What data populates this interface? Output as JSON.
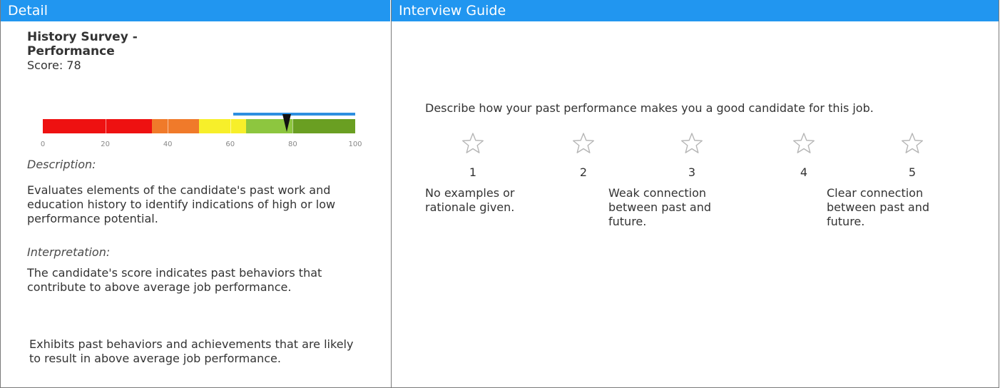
{
  "detail": {
    "header": "Detail",
    "title": "History Survey - Performance",
    "score_text": "Score: 78",
    "gauge": {
      "score": 78,
      "range": [
        0,
        100
      ],
      "above_average_band": [
        60,
        100
      ],
      "segments": [
        {
          "from": 0,
          "to": 35,
          "color": "#ee1111"
        },
        {
          "from": 35,
          "to": 50,
          "color": "#f07a2a"
        },
        {
          "from": 50,
          "to": 65,
          "color": "#f7ef2a"
        },
        {
          "from": 65,
          "to": 80,
          "color": "#8dc63f"
        },
        {
          "from": 80,
          "to": 100,
          "color": "#6a9f22"
        }
      ],
      "ticks": [
        "0",
        "20",
        "40",
        "60",
        "80",
        "100"
      ]
    },
    "description_label": "Description:",
    "description_text": "Evaluates elements of the candidate's past work and education history to identify indications of high or low performance potential.",
    "interpretation_label": "Interpretation:",
    "interpretation_text": "The candidate's score indicates past behaviors that contribute to above average job performance.",
    "summary_text": "Exhibits past behaviors and achievements that are likely to result in above average job performance."
  },
  "guide": {
    "header": "Interview Guide",
    "question": "Describe how your past performance makes you a good candidate for this job.",
    "ratings": [
      "1",
      "2",
      "3",
      "4",
      "5"
    ],
    "anchors": {
      "low": "No examples or rationale given.",
      "mid": "Weak connection between past and future.",
      "high": "Clear connection between past and future."
    }
  }
}
